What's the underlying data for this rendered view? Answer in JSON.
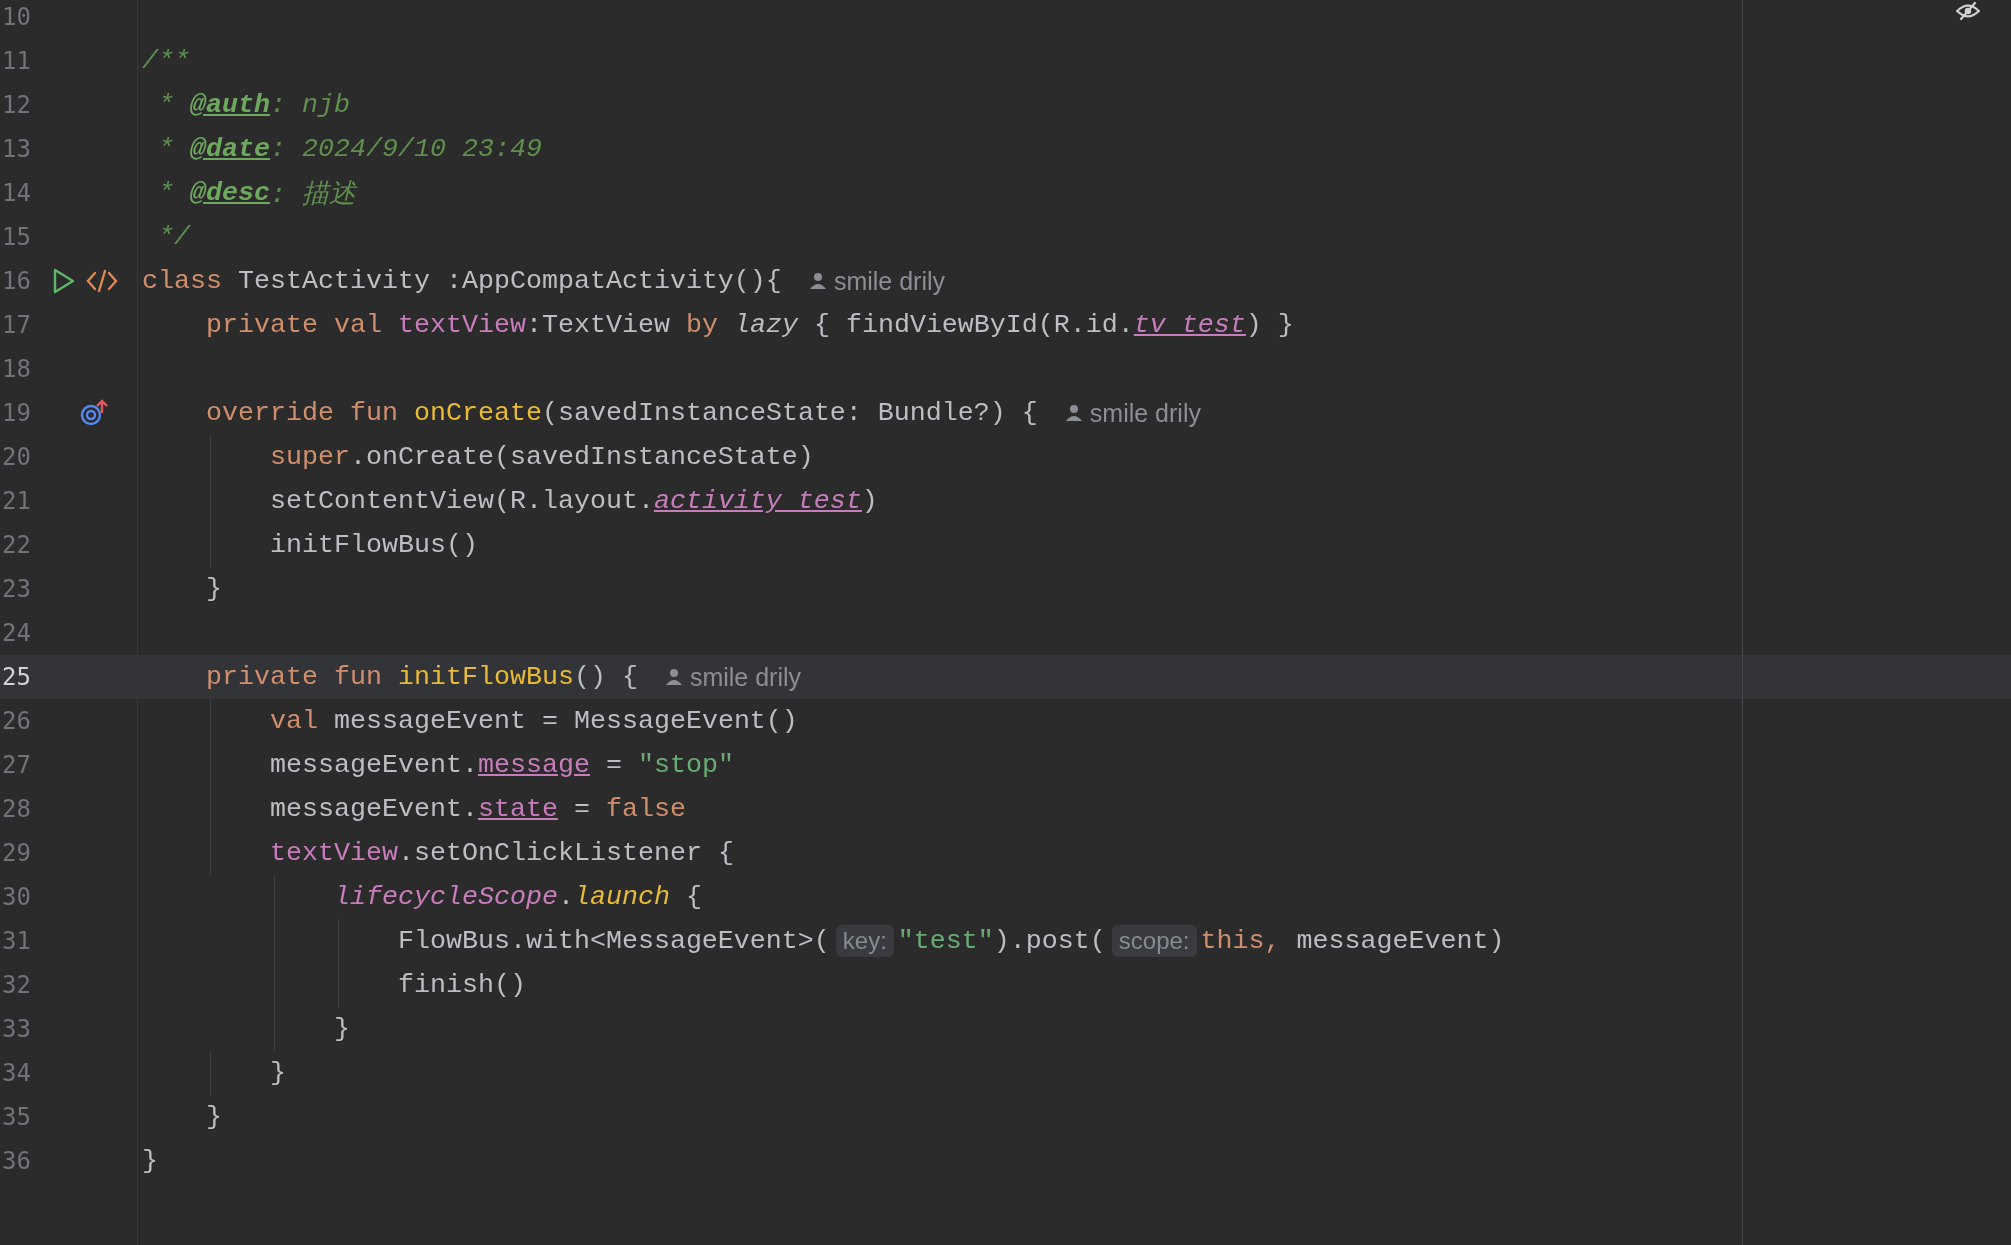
{
  "editor": {
    "lines": [
      {
        "number": "10",
        "current": false
      },
      {
        "number": "11",
        "current": false,
        "tokens": [
          {
            "kind": "comment",
            "text": "/**"
          }
        ]
      },
      {
        "number": "12",
        "current": false,
        "tokens": [
          {
            "kind": "comment",
            "text": " * "
          },
          {
            "kind": "doctag",
            "text": "@auth"
          },
          {
            "kind": "comment",
            "text": ": njb"
          }
        ]
      },
      {
        "number": "13",
        "current": false,
        "tokens": [
          {
            "kind": "comment",
            "text": " * "
          },
          {
            "kind": "doctag",
            "text": "@date"
          },
          {
            "kind": "comment",
            "text": ": 2024/9/10 23:49"
          }
        ]
      },
      {
        "number": "14",
        "current": false,
        "tokens": [
          {
            "kind": "comment",
            "text": " * "
          },
          {
            "kind": "doctag",
            "text": "@desc"
          },
          {
            "kind": "comment",
            "text": ": 描述"
          }
        ]
      },
      {
        "number": "15",
        "current": false,
        "tokens": [
          {
            "kind": "comment",
            "text": " */"
          }
        ]
      },
      {
        "number": "16",
        "current": false,
        "gutter_icons": [
          {
            "kind": "run"
          },
          {
            "kind": "markup"
          }
        ],
        "tokens": [
          {
            "kind": "kw",
            "text": "class "
          },
          {
            "kind": "plain",
            "text": "TestActivity :AppCompatActivity(){"
          },
          {
            "kind": "author",
            "text": "smile drily"
          }
        ]
      },
      {
        "number": "17",
        "current": false,
        "tokens": [
          {
            "kind": "kw",
            "text": "    private val "
          },
          {
            "kind": "field",
            "text": "textView"
          },
          {
            "kind": "plain",
            "text": ":TextView "
          },
          {
            "kind": "kw",
            "text": "by "
          },
          {
            "kind": "italic",
            "text": "lazy"
          },
          {
            "kind": "plain",
            "text": " { findViewById(R.id."
          },
          {
            "kind": "prop-italic",
            "text": "tv_test"
          },
          {
            "kind": "plain",
            "text": ") }"
          }
        ]
      },
      {
        "number": "18",
        "current": false
      },
      {
        "number": "19",
        "current": false,
        "gutter_icons": [
          {
            "kind": "override"
          }
        ],
        "tokens": [
          {
            "kind": "kw",
            "text": "    override fun "
          },
          {
            "kind": "fndecl",
            "text": "onCreate"
          },
          {
            "kind": "plain",
            "text": "(savedInstanceState: Bundle?) {"
          },
          {
            "kind": "author",
            "text": "smile drily"
          }
        ]
      },
      {
        "number": "20",
        "current": false,
        "tokens": [
          {
            "kind": "kw",
            "text": "        super"
          },
          {
            "kind": "plain",
            "text": ".onCreate(savedInstanceState)"
          }
        ]
      },
      {
        "number": "21",
        "current": false,
        "tokens": [
          {
            "kind": "plain",
            "text": "        setContentView(R.layout."
          },
          {
            "kind": "prop-italic",
            "text": "activity_test"
          },
          {
            "kind": "plain",
            "text": ")"
          }
        ]
      },
      {
        "number": "22",
        "current": false,
        "tokens": [
          {
            "kind": "plain",
            "text": "        initFlowBus()"
          }
        ]
      },
      {
        "number": "23",
        "current": false,
        "tokens": [
          {
            "kind": "plain",
            "text": "    }"
          }
        ]
      },
      {
        "number": "24",
        "current": false
      },
      {
        "number": "25",
        "current": true,
        "tokens": [
          {
            "kind": "kw",
            "text": "    private fun "
          },
          {
            "kind": "fndecl",
            "text": "initFlowBus"
          },
          {
            "kind": "plain",
            "text": "() {"
          },
          {
            "kind": "author",
            "text": "smile drily"
          }
        ]
      },
      {
        "number": "26",
        "current": false,
        "tokens": [
          {
            "kind": "kw",
            "text": "        val "
          },
          {
            "kind": "plain",
            "text": "messageEvent = MessageEvent()"
          }
        ]
      },
      {
        "number": "27",
        "current": false,
        "tokens": [
          {
            "kind": "plain",
            "text": "        messageEvent."
          },
          {
            "kind": "prop",
            "text": "message"
          },
          {
            "kind": "plain",
            "text": " = "
          },
          {
            "kind": "string",
            "text": "\"stop\""
          }
        ]
      },
      {
        "number": "28",
        "current": false,
        "tokens": [
          {
            "kind": "plain",
            "text": "        messageEvent."
          },
          {
            "kind": "prop",
            "text": "state"
          },
          {
            "kind": "plain",
            "text": " = "
          },
          {
            "kind": "kw",
            "text": "false"
          }
        ]
      },
      {
        "number": "29",
        "current": false,
        "tokens": [
          {
            "kind": "field",
            "text": "        textView"
          },
          {
            "kind": "plain",
            "text": ".setOnClickListener {"
          }
        ]
      },
      {
        "number": "30",
        "current": false,
        "tokens": [
          {
            "kind": "ext-field",
            "text": "            lifecycleScope"
          },
          {
            "kind": "plain",
            "text": "."
          },
          {
            "kind": "ext-fn",
            "text": "launch"
          },
          {
            "kind": "plain",
            "text": " {"
          }
        ]
      },
      {
        "number": "31",
        "current": false,
        "tokens": [
          {
            "kind": "plain",
            "text": "                FlowBus.with<MessageEvent>("
          },
          {
            "kind": "param",
            "text": "key:"
          },
          {
            "kind": "string",
            "text": "\"test\""
          },
          {
            "kind": "plain",
            "text": ").post("
          },
          {
            "kind": "param",
            "text": "scope:"
          },
          {
            "kind": "kw",
            "text": "this, "
          },
          {
            "kind": "plain",
            "text": "messageEvent)"
          }
        ]
      },
      {
        "number": "32",
        "current": false,
        "tokens": [
          {
            "kind": "plain",
            "text": "                finish()"
          }
        ]
      },
      {
        "number": "33",
        "current": false,
        "tokens": [
          {
            "kind": "plain",
            "text": "            }"
          }
        ]
      },
      {
        "number": "34",
        "current": false,
        "tokens": [
          {
            "kind": "plain",
            "text": "        }"
          }
        ]
      },
      {
        "number": "35",
        "current": false,
        "tokens": [
          {
            "kind": "plain",
            "text": "    }"
          }
        ]
      },
      {
        "number": "36",
        "current": false,
        "tokens": [
          {
            "kind": "plain",
            "text": "}"
          }
        ]
      }
    ]
  }
}
